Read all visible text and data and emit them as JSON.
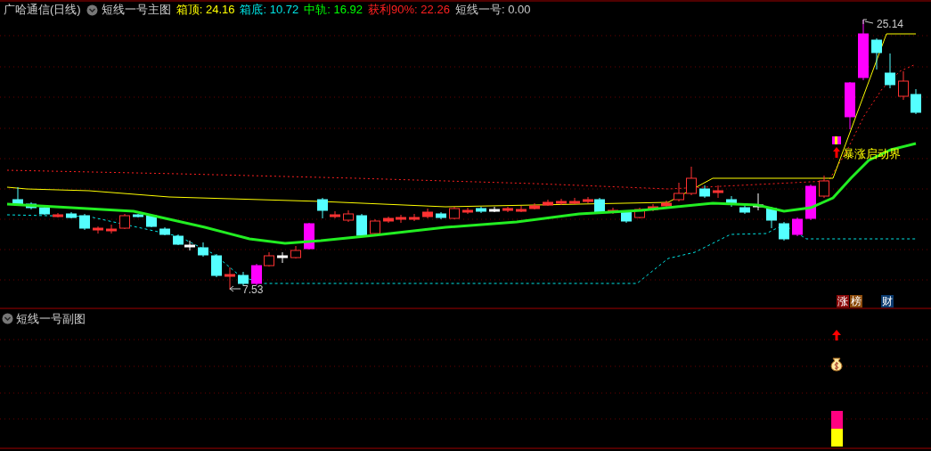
{
  "header": {
    "title": "广哈通信(日线)",
    "indicator": "短线一号主图",
    "readings": [
      {
        "label": "箱顶:",
        "value": "24.16",
        "color": "#ffff00"
      },
      {
        "label": "箱底:",
        "value": "10.72",
        "color": "#00e5e5"
      },
      {
        "label": "中轨:",
        "value": "16.92",
        "color": "#00ff00"
      },
      {
        "label": "获利90%:",
        "value": "22.26",
        "color": "#ff2020"
      },
      {
        "label": "短线一号:",
        "value": "0.00",
        "color": "#c8c8c8"
      }
    ]
  },
  "main_chart": {
    "high_label": "25.14",
    "low_label": "7.53",
    "signal_label": "暴涨启动界",
    "badges": [
      {
        "text": "涨",
        "color": "#8b0a0a"
      },
      {
        "text": "榜",
        "color": "#8b4a0a"
      },
      {
        "text": "财",
        "color": "#0a3a6e"
      }
    ]
  },
  "sub_panel": {
    "title": "短线一号副图"
  }
}
